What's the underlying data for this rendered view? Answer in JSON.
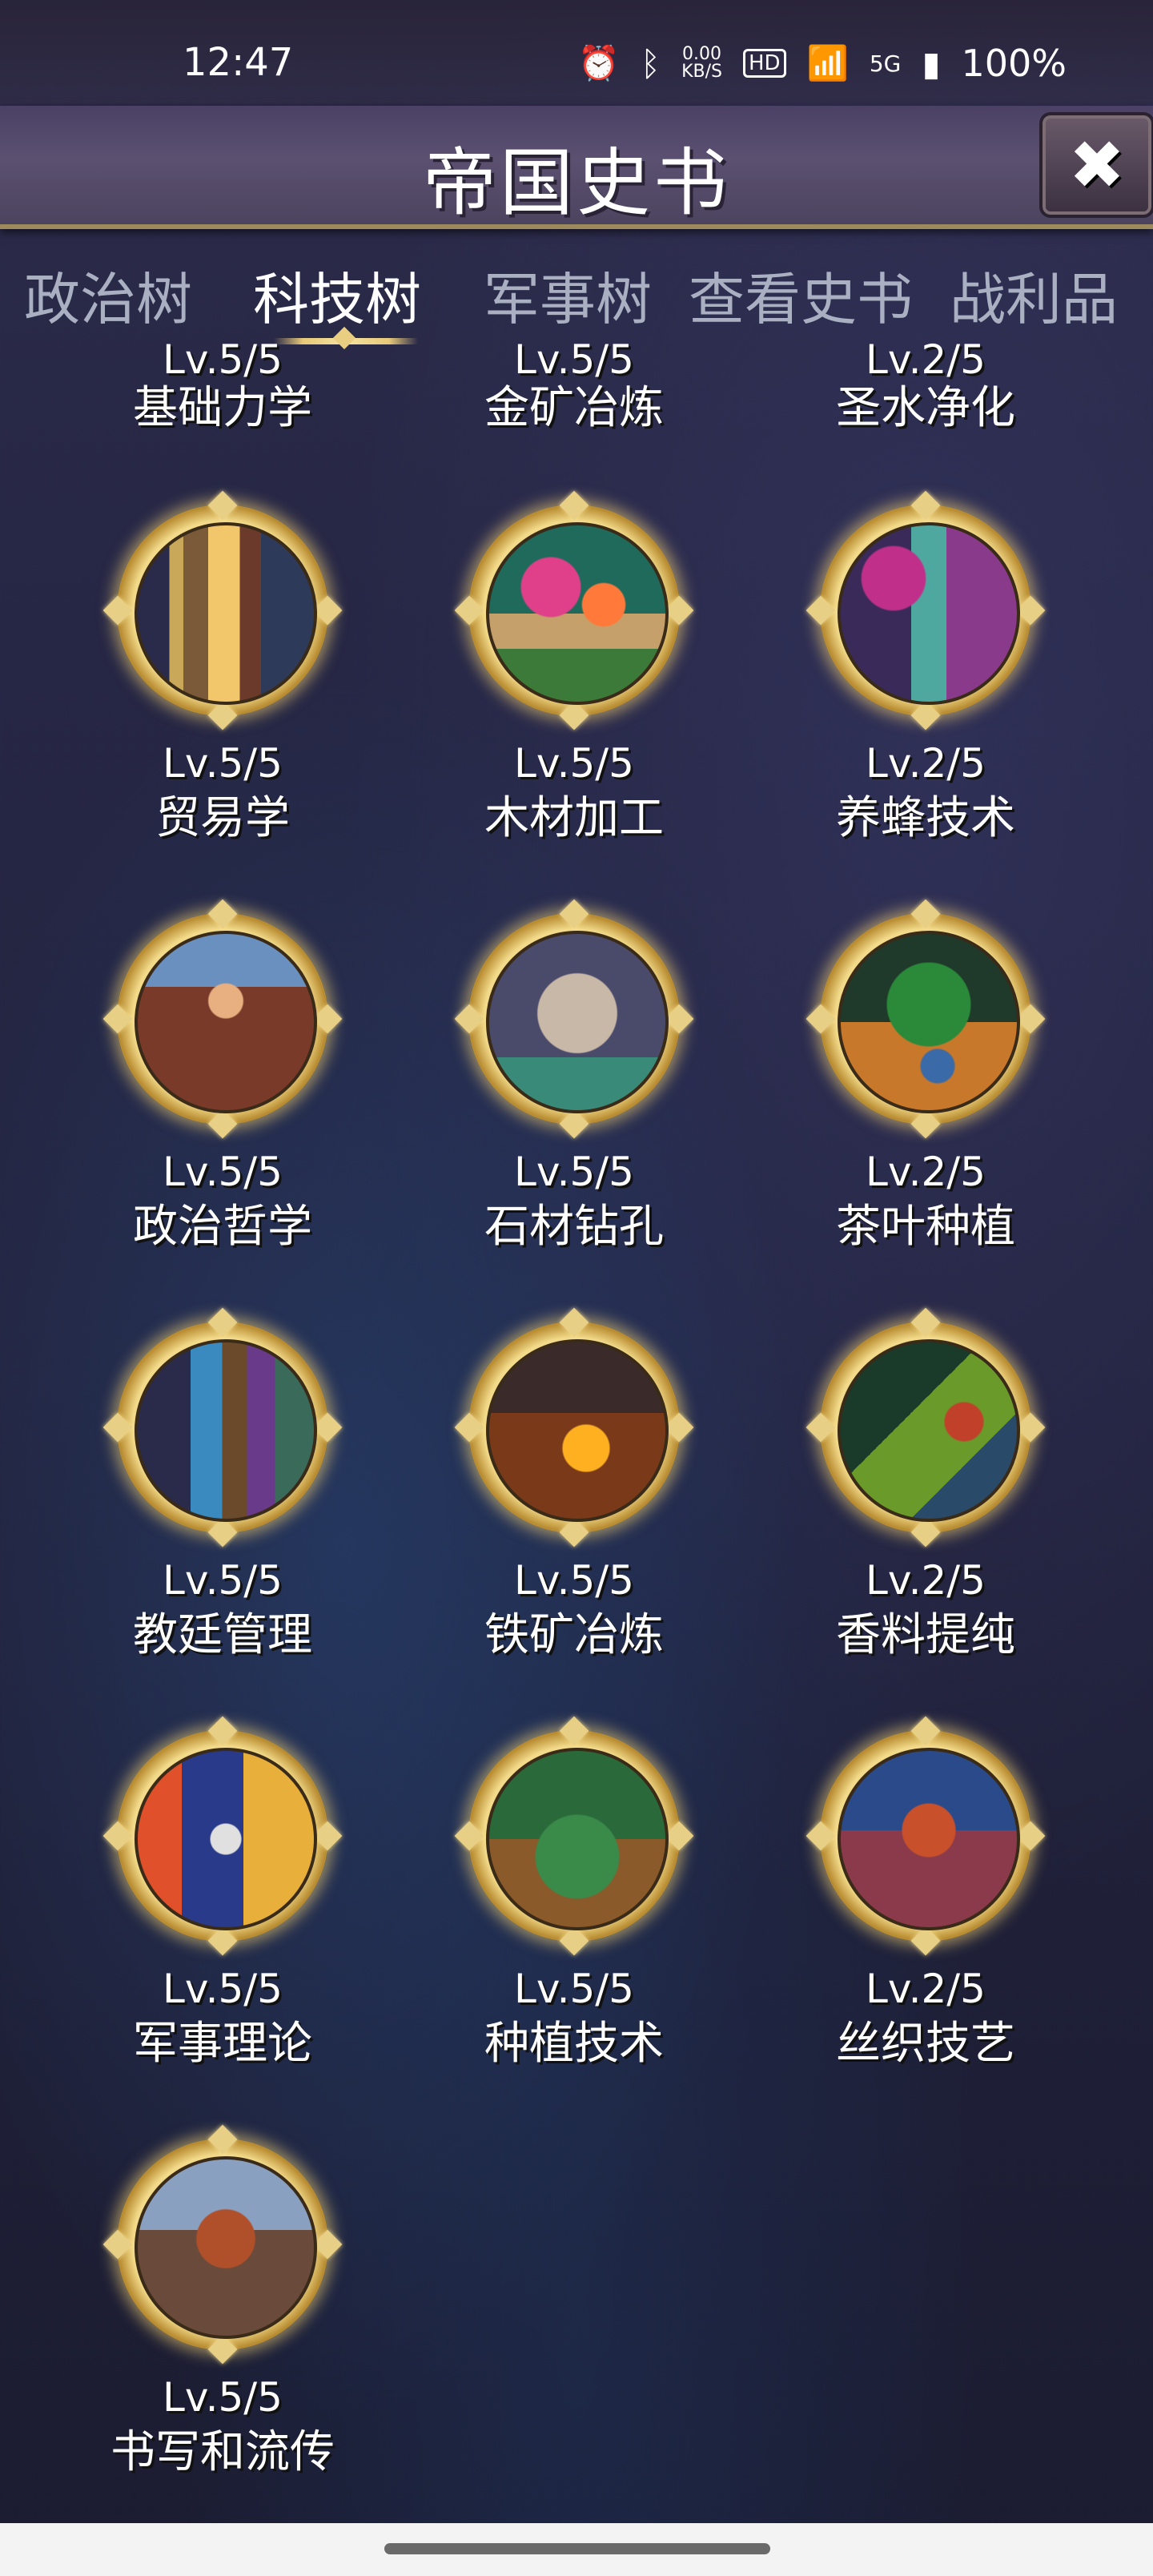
{
  "status_bar": {
    "time": "12:47",
    "net_speed": "0.00",
    "net_unit": "KB/S",
    "hd": "HD",
    "signal": "5G",
    "battery": "100%",
    "icons": [
      "alarm-icon",
      "bluetooth-icon",
      "wifi-icon",
      "signal-icon",
      "battery-icon"
    ]
  },
  "header": {
    "title": "帝国史书",
    "close_label": "✖"
  },
  "tabs": [
    {
      "label": "政治树",
      "active": false
    },
    {
      "label": "科技树",
      "active": true
    },
    {
      "label": "军事树",
      "active": false
    },
    {
      "label": "查看史书",
      "active": false
    },
    {
      "label": "战利品",
      "active": false
    }
  ],
  "techs": [
    {
      "name": "基础力学",
      "level": "Lv.5/5"
    },
    {
      "name": "金矿冶炼",
      "level": "Lv.5/5"
    },
    {
      "name": "圣水净化",
      "level": "Lv.2/5"
    },
    {
      "name": "贸易学",
      "level": "Lv.5/5"
    },
    {
      "name": "木材加工",
      "level": "Lv.5/5"
    },
    {
      "name": "养蜂技术",
      "level": "Lv.2/5"
    },
    {
      "name": "政治哲学",
      "level": "Lv.5/5"
    },
    {
      "name": "石材钻孔",
      "level": "Lv.5/5"
    },
    {
      "name": "茶叶种植",
      "level": "Lv.2/5"
    },
    {
      "name": "教廷管理",
      "level": "Lv.5/5"
    },
    {
      "name": "铁矿冶炼",
      "level": "Lv.5/5"
    },
    {
      "name": "香料提纯",
      "level": "Lv.2/5"
    },
    {
      "name": "军事理论",
      "level": "Lv.5/5"
    },
    {
      "name": "种植技术",
      "level": "Lv.5/5"
    },
    {
      "name": "丝织技艺",
      "level": "Lv.2/5"
    },
    {
      "name": "书写和流传",
      "level": "Lv.5/5"
    }
  ]
}
